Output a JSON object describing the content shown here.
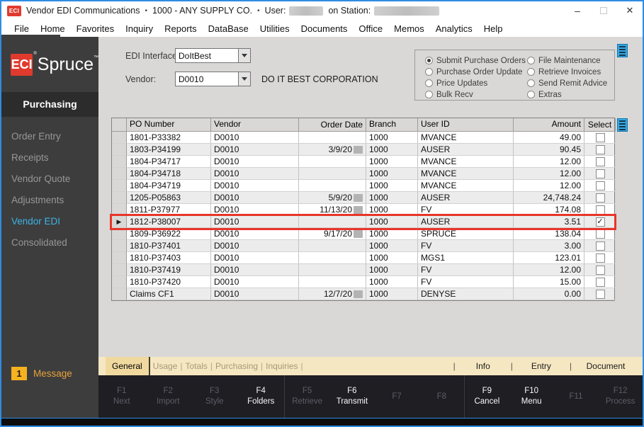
{
  "colors": {
    "brand_red": "#e03a2e",
    "active_cyan": "#3cb4e6",
    "badge_yellow": "#f5b120",
    "highlight_red": "#e8352a",
    "burger_blue": "#35aae3",
    "window_border_blue": "#2e8ce2"
  },
  "titlebar": {
    "logo": "ECI",
    "app_title": "Vendor EDI Communications",
    "separator": "•",
    "company": "1000 - ANY SUPPLY CO.",
    "user_label": "User:",
    "station_label": "on Station:",
    "minimize": "–",
    "close": "✕"
  },
  "menubar": {
    "items": [
      "File",
      "Home",
      "Favorites",
      "Inquiry",
      "Reports",
      "DataBase",
      "Utilities",
      "Documents",
      "Office",
      "Memos",
      "Analytics",
      "Help"
    ]
  },
  "sidebar": {
    "logo_eci": "ECI",
    "logo_reg": "®",
    "logo_spruce": "Spruce",
    "logo_tm": "™",
    "section": "Purchasing",
    "items": [
      {
        "label": "Order Entry",
        "active": false
      },
      {
        "label": "Receipts",
        "active": false
      },
      {
        "label": "Vendor Quote",
        "active": false
      },
      {
        "label": "Adjustments",
        "active": false
      },
      {
        "label": "Vendor EDI",
        "active": true
      },
      {
        "label": "Consolidated",
        "active": false
      }
    ],
    "message_count": "1",
    "message_label": "Message"
  },
  "form": {
    "edi_interface_label": "EDI Interface:",
    "edi_interface_value": "DoItBest",
    "vendor_label": "Vendor:",
    "vendor_value": "D0010",
    "vendor_name": "DO IT BEST CORPORATION"
  },
  "operations": {
    "selected": "Submit Purchase Orders",
    "col1": [
      "Submit Purchase Orders",
      "Purchase Order Update",
      "Price Updates",
      "Bulk Recv"
    ],
    "col2": [
      "File Maintenance",
      "Retrieve Invoices",
      "Send Remit Advice",
      "Extras"
    ]
  },
  "table": {
    "columns": [
      "PO Number",
      "Vendor",
      "Order Date",
      "Branch",
      "User ID",
      "Amount",
      "Select"
    ],
    "rows": [
      {
        "po": "1801-P33382",
        "vendor": "D0010",
        "date": "",
        "date_blur": false,
        "branch": "1000",
        "user": "MVANCE",
        "amount": "49.00",
        "checked": false,
        "highlighted": false
      },
      {
        "po": "1803-P34199",
        "vendor": "D0010",
        "date": "3/9/20",
        "date_blur": true,
        "branch": "1000",
        "user": "AUSER",
        "amount": "90.45",
        "checked": false,
        "highlighted": false
      },
      {
        "po": "1804-P34717",
        "vendor": "D0010",
        "date": "",
        "date_blur": false,
        "branch": "1000",
        "user": "MVANCE",
        "amount": "12.00",
        "checked": false,
        "highlighted": false
      },
      {
        "po": "1804-P34718",
        "vendor": "D0010",
        "date": "",
        "date_blur": false,
        "branch": "1000",
        "user": "MVANCE",
        "amount": "12.00",
        "checked": false,
        "highlighted": false
      },
      {
        "po": "1804-P34719",
        "vendor": "D0010",
        "date": "",
        "date_blur": false,
        "branch": "1000",
        "user": "MVANCE",
        "amount": "12.00",
        "checked": false,
        "highlighted": false
      },
      {
        "po": "1205-P05863",
        "vendor": "D0010",
        "date": "5/9/20",
        "date_blur": true,
        "branch": "1000",
        "user": "AUSER",
        "amount": "24,748.24",
        "checked": false,
        "highlighted": false
      },
      {
        "po": "1811-P37977",
        "vendor": "D0010",
        "date": "11/13/20",
        "date_blur": true,
        "branch": "1000",
        "user": "FV",
        "amount": "174.08",
        "checked": false,
        "highlighted": false
      },
      {
        "po": "1812-P38007",
        "vendor": "D0010",
        "date": "",
        "date_blur": false,
        "branch": "1000",
        "user": "AUSER",
        "amount": "3.51",
        "checked": true,
        "highlighted": true
      },
      {
        "po": "1809-P36922",
        "vendor": "D0010",
        "date": "9/17/20",
        "date_blur": true,
        "branch": "1000",
        "user": "SPRUCE",
        "amount": "138.04",
        "checked": false,
        "highlighted": false
      },
      {
        "po": "1810-P37401",
        "vendor": "D0010",
        "date": "",
        "date_blur": false,
        "branch": "1000",
        "user": "FV",
        "amount": "3.00",
        "checked": false,
        "highlighted": false
      },
      {
        "po": "1810-P37403",
        "vendor": "D0010",
        "date": "",
        "date_blur": false,
        "branch": "1000",
        "user": "MGS1",
        "amount": "123.01",
        "checked": false,
        "highlighted": false
      },
      {
        "po": "1810-P37419",
        "vendor": "D0010",
        "date": "",
        "date_blur": false,
        "branch": "1000",
        "user": "FV",
        "amount": "12.00",
        "checked": false,
        "highlighted": false
      },
      {
        "po": "1810-P37420",
        "vendor": "D0010",
        "date": "",
        "date_blur": false,
        "branch": "1000",
        "user": "FV",
        "amount": "15.00",
        "checked": false,
        "highlighted": false
      },
      {
        "po": "Claims CF1",
        "vendor": "D0010",
        "date": "12/7/20",
        "date_blur": true,
        "branch": "1000",
        "user": "DENYSE",
        "amount": "0.00",
        "checked": false,
        "highlighted": false
      }
    ]
  },
  "tabs": {
    "left": [
      {
        "label": "General",
        "active": true
      },
      {
        "label": "Usage",
        "active": false
      },
      {
        "label": "Totals",
        "active": false
      },
      {
        "label": "Purchasing",
        "active": false
      },
      {
        "label": "Inquiries",
        "active": false
      }
    ],
    "right": [
      "Info",
      "Entry",
      "Document"
    ]
  },
  "function_keys": [
    {
      "key": "F1",
      "label": "Next",
      "enabled": false
    },
    {
      "key": "F2",
      "label": "Import",
      "enabled": false
    },
    {
      "key": "F3",
      "label": "Style",
      "enabled": false
    },
    {
      "key": "F4",
      "label": "Folders",
      "enabled": true
    },
    {
      "key": "F5",
      "label": "Retrieve",
      "enabled": false
    },
    {
      "key": "F6",
      "label": "Transmit",
      "enabled": true
    },
    {
      "key": "F7",
      "label": "",
      "enabled": false
    },
    {
      "key": "F8",
      "label": "",
      "enabled": false
    },
    {
      "key": "F9",
      "label": "Cancel",
      "enabled": true
    },
    {
      "key": "F10",
      "label": "Menu",
      "enabled": true
    },
    {
      "key": "F11",
      "label": "",
      "enabled": false
    },
    {
      "key": "F12",
      "label": "Process",
      "enabled": false
    }
  ]
}
